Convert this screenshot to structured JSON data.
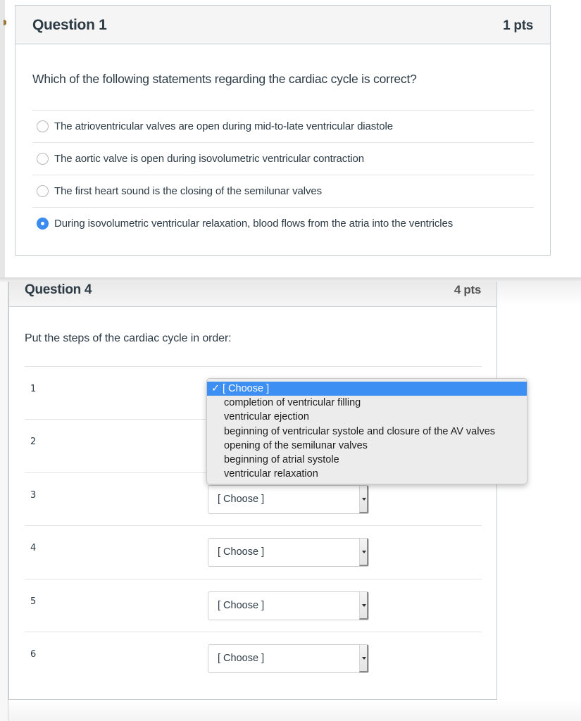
{
  "question1": {
    "title": "Question 1",
    "points": "1 pts",
    "text": "Which of the following statements regarding the cardiac cycle is correct?",
    "answers": [
      {
        "label": "The atrioventricular valves are open during mid-to-late ventricular diastole",
        "selected": false
      },
      {
        "label": "The aortic valve is open during isovolumetric ventricular contraction",
        "selected": false
      },
      {
        "label": "The first heart sound is the closing of the semilunar valves",
        "selected": false
      },
      {
        "label": "During isovolumetric ventricular relaxation, blood flows from the atria into the ventricles",
        "selected": true
      }
    ]
  },
  "question4": {
    "title": "Question 4",
    "points": "4 pts",
    "text": "Put the steps of the cardiac cycle in order:",
    "rows": [
      {
        "number": "1",
        "value": "[ Choose ]"
      },
      {
        "number": "2",
        "value": "[ Choose ]"
      },
      {
        "number": "3",
        "value": "[ Choose ]"
      },
      {
        "number": "4",
        "value": "[ Choose ]"
      },
      {
        "number": "5",
        "value": "[ Choose ]"
      },
      {
        "number": "6",
        "value": "[ Choose ]"
      }
    ],
    "dropdown": {
      "check_glyph": "✓",
      "options": [
        {
          "label": "[ Choose ]",
          "selected": true
        },
        {
          "label": "completion of ventricular filling",
          "selected": false
        },
        {
          "label": "ventricular ejection",
          "selected": false
        },
        {
          "label": "beginning of ventricular systole and closure of the AV valves",
          "selected": false
        },
        {
          "label": "opening of the semilunar valves",
          "selected": false
        },
        {
          "label": "beginning of atrial systole",
          "selected": false
        },
        {
          "label": "ventricular relaxation",
          "selected": false
        }
      ]
    }
  },
  "colors": {
    "radio_selected": "#3a8cf0",
    "dropdown_highlight": "#3d8ff3",
    "text": "#2d3b45"
  }
}
